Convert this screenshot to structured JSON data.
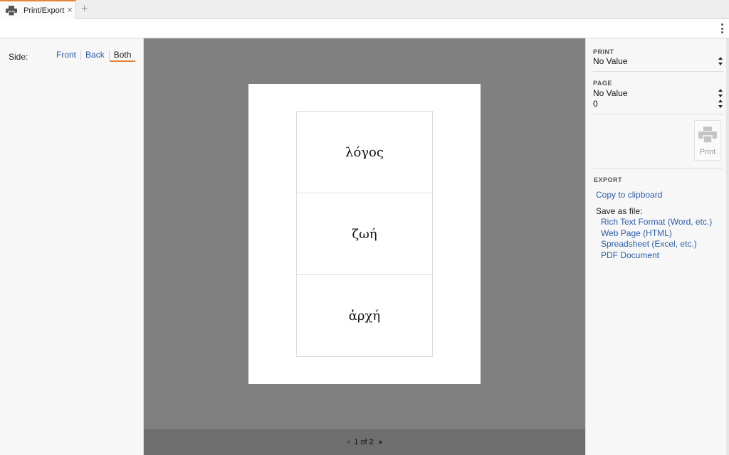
{
  "tabs": [
    {
      "label": "Print/Export",
      "icon": "printer-icon",
      "active": true
    }
  ],
  "side": {
    "label": "Side:",
    "options": [
      "Front",
      "Back",
      "Both"
    ],
    "selected": "Both"
  },
  "preview": {
    "cards": [
      "λόγος",
      "ζωή",
      "ἀρχή"
    ],
    "pager": "1 of 2"
  },
  "print_section": {
    "heading": "PRINT",
    "printer_value": "No Value"
  },
  "page_section": {
    "heading": "PAGE",
    "page_value": "No Value",
    "page_number": "0"
  },
  "print_button": {
    "label": "Print"
  },
  "export": {
    "heading": "EXPORT",
    "copy_label": "Copy to clipboard",
    "save_as_label": "Save as file:",
    "formats": [
      "Rich Text Format (Word, etc.)",
      "Web Page (HTML)",
      "Spreadsheet (Excel, etc.)",
      "PDF Document"
    ]
  },
  "colors": {
    "accent": "#e8833a",
    "link": "#2a5ea8",
    "preview_bg": "#808080"
  }
}
